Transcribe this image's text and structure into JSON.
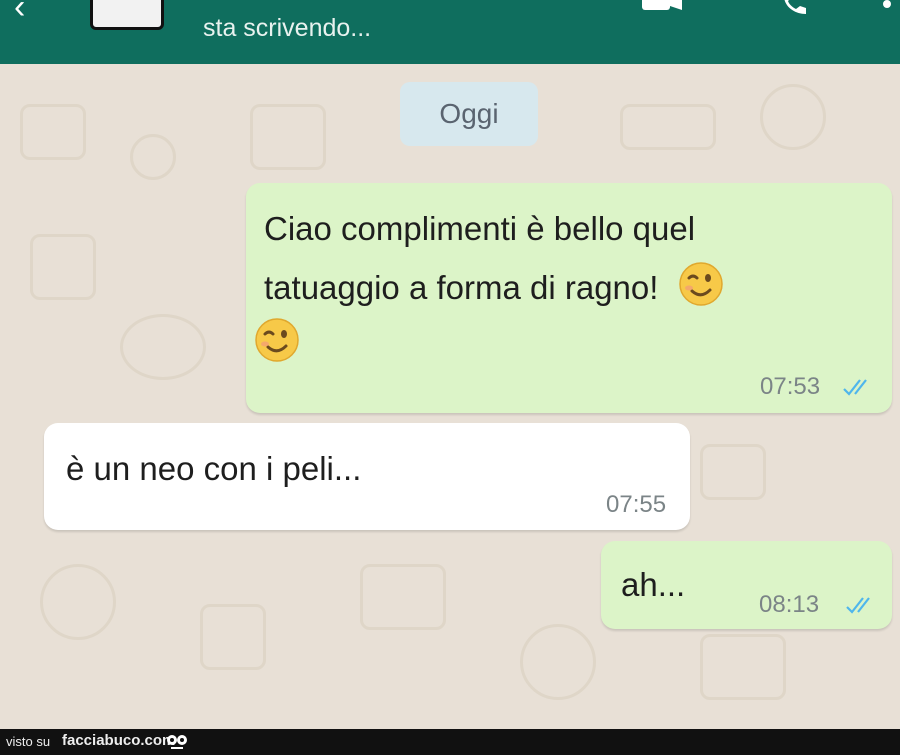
{
  "header": {
    "status": "sta scrivendo...",
    "back_icon": "arrow-left-icon",
    "icons": [
      "video-call-icon",
      "phone-icon",
      "more-vert-icon"
    ],
    "color": "#0f6e5e"
  },
  "chat": {
    "date_chip": "Oggi",
    "messages": [
      {
        "direction": "outgoing",
        "line1": "Ciao complimenti è bello quel",
        "line2": "tatuaggio a forma di ragno!",
        "emoji": "winking-face-emoji",
        "time": "07:53",
        "status": "read"
      },
      {
        "direction": "incoming",
        "text": "è un neo con i peli...",
        "time": "07:55"
      },
      {
        "direction": "outgoing",
        "text": "ah...",
        "time": "08:13",
        "status": "read"
      }
    ],
    "outgoing_bubble_color": "#dcf4c8",
    "incoming_bubble_color": "#ffffff",
    "tick_color": "#4fb6ec"
  },
  "footer": {
    "prefix": "visto su",
    "brand": "facciabuco.com"
  }
}
